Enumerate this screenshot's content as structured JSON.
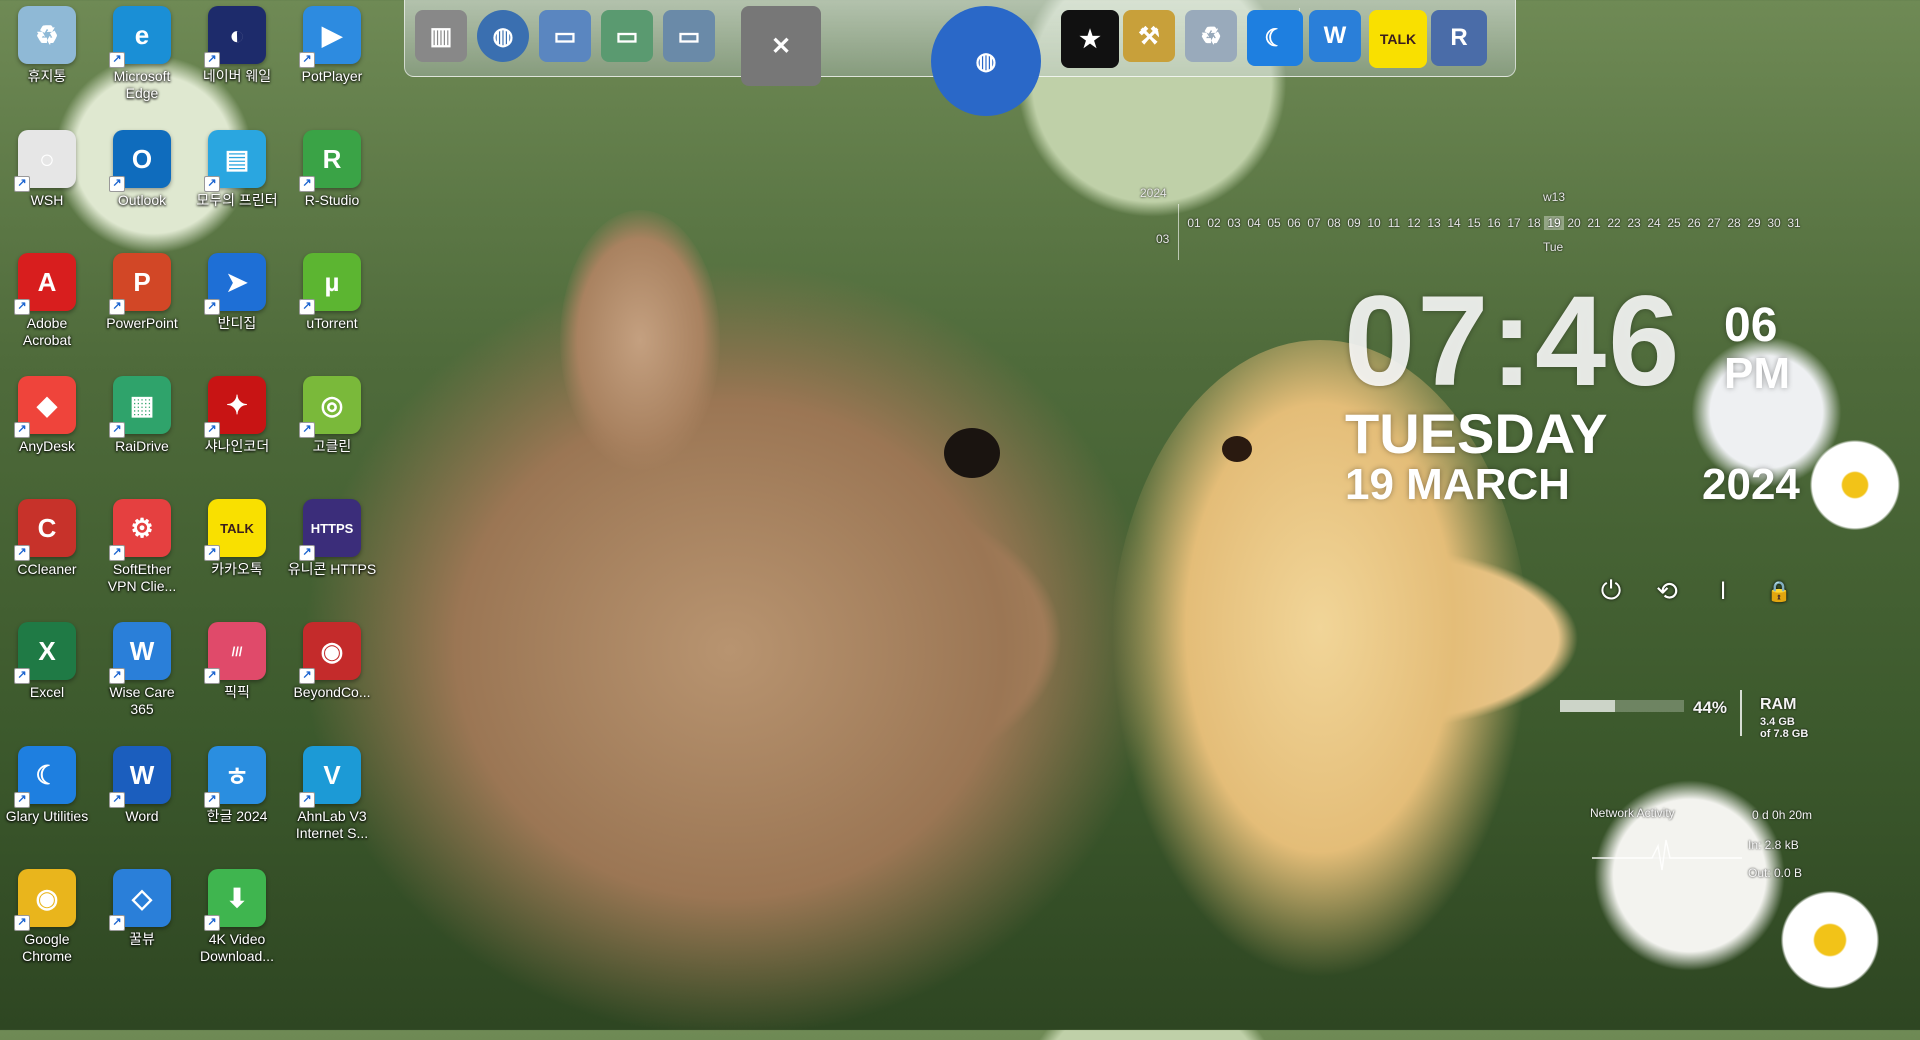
{
  "desktop_icons": [
    {
      "label": "휴지통",
      "color": "#8fb9d6",
      "glyph": "♻"
    },
    {
      "label": "Microsoft Edge",
      "color": "#1a8fd6",
      "glyph": "e"
    },
    {
      "label": "네이버 웨일",
      "color": "#1d2b6b",
      "glyph": "◐"
    },
    {
      "label": "PotPlayer",
      "color": "#2d8be0",
      "glyph": "▶"
    },
    {
      "label": "WSH",
      "color": "#e6e6e6",
      "glyph": "○"
    },
    {
      "label": "Outlook",
      "color": "#0f6cbd",
      "glyph": "O"
    },
    {
      "label": "모두의 프린터",
      "color": "#2aa6e0",
      "glyph": "▤"
    },
    {
      "label": "R-Studio",
      "color": "#3aa346",
      "glyph": "R"
    },
    {
      "label": "Adobe Acrobat",
      "color": "#d81e1e",
      "glyph": "A"
    },
    {
      "label": "PowerPoint",
      "color": "#d24726",
      "glyph": "P"
    },
    {
      "label": "반디집",
      "color": "#1e6fd6",
      "glyph": "➤"
    },
    {
      "label": "uTorrent",
      "color": "#5cb531",
      "glyph": "µ"
    },
    {
      "label": "AnyDesk",
      "color": "#ef443b",
      "glyph": "◆"
    },
    {
      "label": "RaiDrive",
      "color": "#2fa36b",
      "glyph": "▦"
    },
    {
      "label": "샤나인코더",
      "color": "#c81414",
      "glyph": "✦"
    },
    {
      "label": "고클린",
      "color": "#7ab93a",
      "glyph": "◎"
    },
    {
      "label": "CCleaner",
      "color": "#c7322a",
      "glyph": "C"
    },
    {
      "label": "SoftEther VPN Clie...",
      "color": "#e54040",
      "glyph": "⚙"
    },
    {
      "label": "카카오톡",
      "color": "#f9e000",
      "glyph": "TALK"
    },
    {
      "label": "유니콘 HTTPS",
      "color": "#3b2d7a",
      "glyph": "HTTPS"
    },
    {
      "label": "Excel",
      "color": "#1f7a45",
      "glyph": "X"
    },
    {
      "label": "Wise Care 365",
      "color": "#2a7fd9",
      "glyph": "W"
    },
    {
      "label": "픽픽",
      "color": "#e04a6a",
      "glyph": "///"
    },
    {
      "label": "BeyondCo...",
      "color": "#c42b2b",
      "glyph": "◉"
    },
    {
      "label": "Glary Utilities",
      "color": "#1e7fe0",
      "glyph": "☾"
    },
    {
      "label": "Word",
      "color": "#1b5ebe",
      "glyph": "W"
    },
    {
      "label": "한글 2024",
      "color": "#2a8ee0",
      "glyph": "ㅎ"
    },
    {
      "label": "AhnLab V3 Internet S...",
      "color": "#1c9ad6",
      "glyph": "V"
    },
    {
      "label": "Google Chrome",
      "color": "#e9b51c",
      "glyph": "◉"
    },
    {
      "label": "꿀뷰",
      "color": "#2a7fd9",
      "glyph": "◇"
    },
    {
      "label": "4K Video Download...",
      "color": "#3fb54f",
      "glyph": "⬇"
    }
  ],
  "dock": {
    "items": [
      {
        "name": "system-monitor-icon",
        "glyph": "▥",
        "color": "#888"
      },
      {
        "name": "network-globe-icon",
        "glyph": "◍",
        "color": "#3a6fb0"
      },
      {
        "name": "folder-icon",
        "glyph": "▭",
        "color": "#5a86c0"
      },
      {
        "name": "folder-green-icon",
        "glyph": "▭",
        "color": "#5a9a70"
      },
      {
        "name": "folder-photos-icon",
        "glyph": "▭",
        "color": "#6a8aa8"
      },
      {
        "name": "tools-icon",
        "glyph": "✕",
        "color": "#777"
      },
      {
        "name": "globe-icon",
        "glyph": "◍",
        "color": "#2a68c8"
      },
      {
        "name": "tshirt-icon",
        "glyph": "★",
        "color": "#111"
      },
      {
        "name": "hammer-icon",
        "glyph": "⚒",
        "color": "#c8a03a"
      },
      {
        "name": "recycle-bin-icon",
        "glyph": "♻",
        "color": "#9ab"
      },
      {
        "name": "glary-icon",
        "glyph": "☾",
        "color": "#1e7fe0"
      },
      {
        "name": "wisecare-icon",
        "glyph": "W",
        "color": "#2a7fd9"
      },
      {
        "name": "kakaotalk-icon",
        "glyph": "TALK",
        "color": "#f9e000"
      },
      {
        "name": "r-icon",
        "glyph": "R",
        "color": "#4a6ca8"
      }
    ]
  },
  "calendar": {
    "year": "2024",
    "month": "03",
    "week": "w13",
    "today_label": "Tue",
    "today": "19",
    "days": [
      "01",
      "02",
      "03",
      "04",
      "05",
      "06",
      "07",
      "08",
      "09",
      "10",
      "11",
      "12",
      "13",
      "14",
      "15",
      "16",
      "17",
      "18",
      "19",
      "20",
      "21",
      "22",
      "23",
      "24",
      "25",
      "26",
      "27",
      "28",
      "29",
      "30",
      "31"
    ]
  },
  "clock": {
    "time": "07:46",
    "seconds": "06",
    "ampm": "PM",
    "weekday": "TUESDAY",
    "date": "19 MARCH",
    "year": "2024"
  },
  "power_controls": [
    {
      "name": "power-icon",
      "glyph": "⏻"
    },
    {
      "name": "restart-icon",
      "glyph": "⟲"
    },
    {
      "name": "standby-icon",
      "glyph": "⏽"
    },
    {
      "name": "lock-icon",
      "glyph": "🔒"
    }
  ],
  "ram": {
    "percent": "44%",
    "fill": 0.44,
    "label": "RAM",
    "used": "3.4 GB",
    "total": "of 7.8 GB"
  },
  "network": {
    "title": "Network Activity",
    "uptime": "0 d 0h 20m",
    "in": "In: 2.8 kB",
    "out": "Out: 0.0 B"
  }
}
